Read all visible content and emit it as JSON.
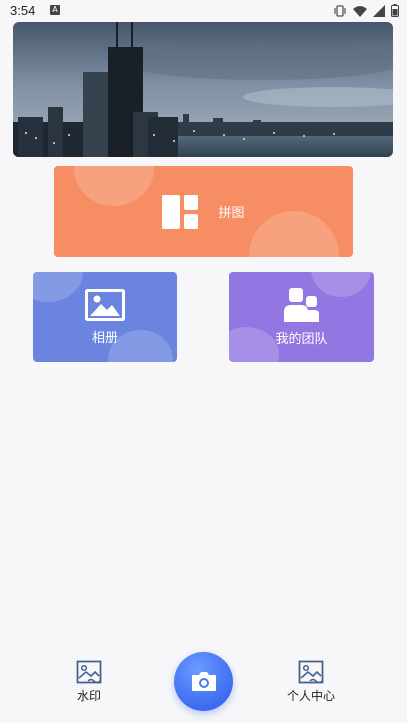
{
  "status_bar": {
    "time": "3:54",
    "notification_badge": "A",
    "icons": [
      "vibrate-icon",
      "wifi-icon",
      "signal-icon",
      "battery-icon"
    ]
  },
  "banner": {
    "image_alt": "city-skyline-image"
  },
  "cards": {
    "puzzle": {
      "label": "拼图",
      "icon": "layout-grid-icon",
      "color": "#f78d63"
    },
    "album": {
      "label": "相册",
      "icon": "image-icon",
      "color": "#6b84e0"
    },
    "team": {
      "label": "我的团队",
      "icon": "team-icon",
      "color": "#9277e2"
    }
  },
  "bottom_nav": {
    "watermark": {
      "label": "水印",
      "icon": "watermark-icon"
    },
    "camera": {
      "icon": "camera-icon",
      "color": "#3d6cf0"
    },
    "profile": {
      "label": "个人中心",
      "icon": "profile-icon"
    }
  }
}
